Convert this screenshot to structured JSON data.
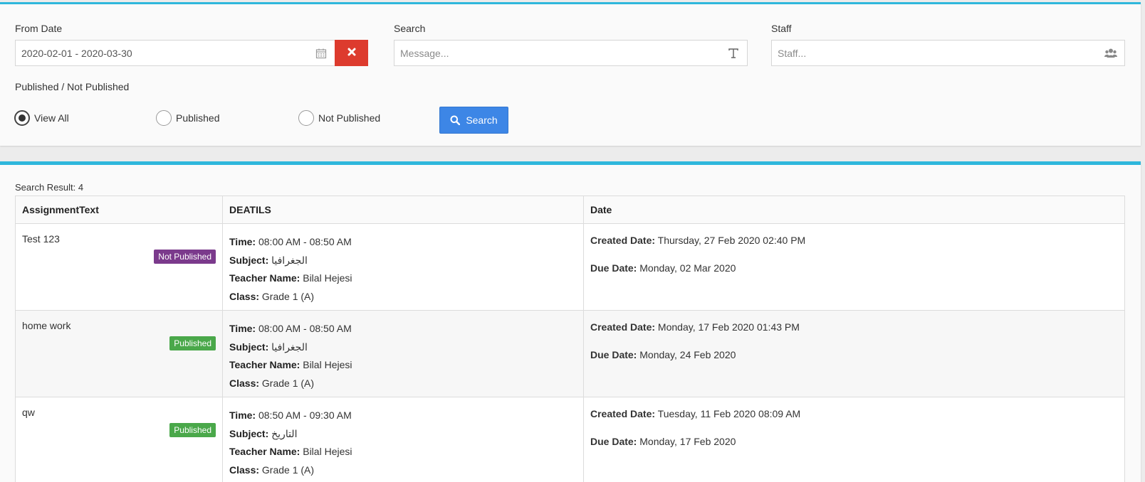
{
  "filters": {
    "from_date_label": "From Date",
    "from_date_value": "2020-02-01 - 2020-03-30",
    "search_label": "Search",
    "search_placeholder": "Message...",
    "staff_label": "Staff",
    "staff_placeholder": "Staff...",
    "published_label": "Published / Not Published",
    "radio_options": [
      {
        "label": "View All",
        "checked": true
      },
      {
        "label": "Published",
        "checked": false
      },
      {
        "label": "Not Published",
        "checked": false
      }
    ],
    "search_button": "Search"
  },
  "results": {
    "count_text": "Search Result: 4",
    "columns": [
      "AssignmentText",
      "DEATILS",
      "Date"
    ],
    "labels": {
      "time": "Time:",
      "subject": "Subject:",
      "teacher": "Teacher Name:",
      "class": "Class:",
      "created": "Created Date:",
      "due": "Due Date:"
    },
    "rows": [
      {
        "assignment": "Test 123",
        "status": "Not Published",
        "time": "08:00 AM - 08:50 AM",
        "subject": "الجغرافيا",
        "teacher": "Bilal Hejesi",
        "class": "Grade 1 (A)",
        "created": "Thursday, 27 Feb 2020 02:40 PM",
        "due": "Monday, 02 Mar 2020"
      },
      {
        "assignment": "home work",
        "status": "Published",
        "time": "08:00 AM - 08:50 AM",
        "subject": "الجغرافيا",
        "teacher": "Bilal Hejesi",
        "class": "Grade 1 (A)",
        "created": "Monday, 17 Feb 2020 01:43 PM",
        "due": "Monday, 24 Feb 2020"
      },
      {
        "assignment": "qw",
        "status": "Published",
        "time": "08:50 AM - 09:30 AM",
        "subject": "التاريخ",
        "teacher": "Bilal Hejesi",
        "class": "Grade 1 (A)",
        "created": "Tuesday, 11 Feb 2020 08:09 AM",
        "due": "Monday, 17 Feb 2020"
      }
    ]
  },
  "colors": {
    "accent_bar": "#2fb7dc",
    "clear_button": "#dd3b2e",
    "search_button": "#3d86e6",
    "badge_published": "#4aa84a",
    "badge_not_published": "#7b3a8c"
  }
}
